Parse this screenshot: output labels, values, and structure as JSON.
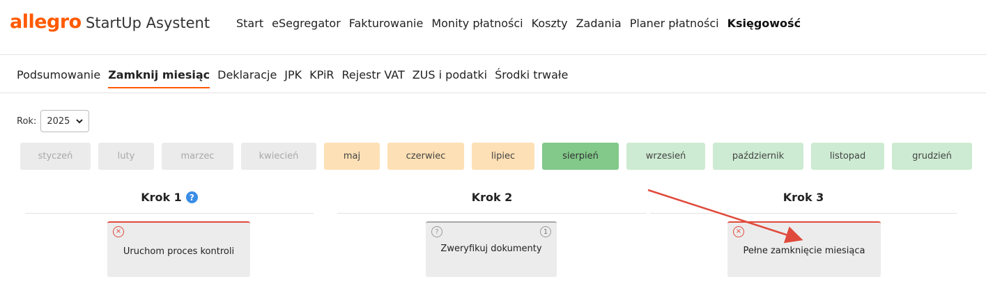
{
  "header": {
    "logo": "allegro",
    "app_name": "StartUp Asystent",
    "nav": [
      "Start",
      "eSegregator",
      "Fakturowanie",
      "Monity płatności",
      "Koszty",
      "Zadania",
      "Planer płatności",
      "Księgowość"
    ],
    "active_nav": "Księgowość"
  },
  "subnav": {
    "tabs": [
      "Podsumowanie",
      "Zamknij miesiąc",
      "Deklaracje",
      "JPK",
      "KPiR",
      "Rejestr VAT",
      "ZUS i podatki",
      "Środki trwałe"
    ],
    "active": "Zamknij miesiąc"
  },
  "year": {
    "label": "Rok:",
    "value": "2025"
  },
  "months": [
    {
      "label": "styczeń",
      "status": "gray"
    },
    {
      "label": "luty",
      "status": "gray"
    },
    {
      "label": "marzec",
      "status": "gray"
    },
    {
      "label": "kwiecień",
      "status": "gray"
    },
    {
      "label": "maj",
      "status": "orange"
    },
    {
      "label": "czerwiec",
      "status": "orange"
    },
    {
      "label": "lipiec",
      "status": "orange"
    },
    {
      "label": "sierpień",
      "status": "green"
    },
    {
      "label": "wrzesień",
      "status": "lightgreen"
    },
    {
      "label": "październik",
      "status": "lightgreen"
    },
    {
      "label": "listopad",
      "status": "lightgreen"
    },
    {
      "label": "grudzień",
      "status": "lightgreen"
    }
  ],
  "steps": [
    {
      "title": "Krok 1",
      "help_icon": "?",
      "card_label": "Uruchom proces kontroli",
      "status_icon": "×"
    },
    {
      "title": "Krok 2",
      "card_label": "Zweryfikuj dokumenty",
      "status_icon": "?",
      "count": "1"
    },
    {
      "title": "Krok 3",
      "card_label": "Pełne zamknięcie miesiąca",
      "status_icon": "×"
    }
  ],
  "colors": {
    "brand": "#ff5a00",
    "month_gray": "#ebebeb",
    "month_orange": "#fde0b5",
    "month_green": "#82c98a",
    "month_lightgreen": "#cdebd2",
    "error": "#e04a3c",
    "help": "#3a8ee6",
    "annotation_arrow": "#e04a3c"
  }
}
